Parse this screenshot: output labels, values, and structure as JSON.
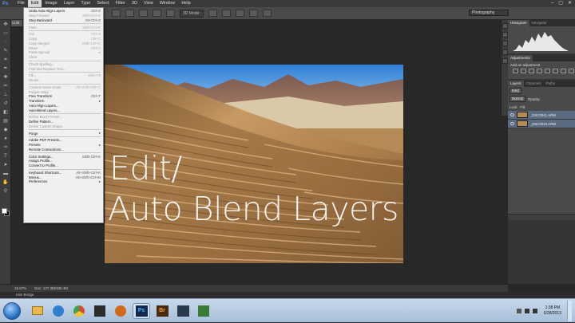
{
  "app": {
    "logo": "Ps"
  },
  "menubar": {
    "items": [
      "File",
      "Edit",
      "Image",
      "Layer",
      "Type",
      "Select",
      "Filter",
      "3D",
      "View",
      "Window",
      "Help"
    ],
    "active": "Edit"
  },
  "window_controls": {
    "minimize": "–",
    "restore": "▢",
    "close": "✕"
  },
  "options_bar": {
    "mode_label": "3D Mode:"
  },
  "workspace": {
    "selected": "Photography"
  },
  "document_tab": {
    "label": "Untit"
  },
  "edit_menu": [
    {
      "label": "Undo Auto-Align Layers",
      "shortcut": "Ctrl+Z"
    },
    {
      "label": "Step Forward",
      "shortcut": "Shift+Ctrl+Z",
      "disabled": true
    },
    {
      "label": "Step Backward",
      "shortcut": "Alt+Ctrl+Z"
    },
    {
      "sep": true
    },
    {
      "label": "Fade...",
      "shortcut": "Shift+Ctrl+F",
      "disabled": true
    },
    {
      "sep": true
    },
    {
      "label": "Cut",
      "shortcut": "Ctrl+X",
      "disabled": true
    },
    {
      "label": "Copy",
      "shortcut": "Ctrl+C",
      "disabled": true
    },
    {
      "label": "Copy Merged",
      "shortcut": "Shift+Ctrl+C",
      "disabled": true
    },
    {
      "label": "Paste",
      "shortcut": "Ctrl+V",
      "disabled": true
    },
    {
      "label": "Paste Special",
      "shortcut": "",
      "disabled": true,
      "submenu": true
    },
    {
      "label": "Clear",
      "shortcut": "",
      "disabled": true
    },
    {
      "sep": true
    },
    {
      "label": "Check Spelling...",
      "shortcut": "",
      "disabled": true
    },
    {
      "label": "Find and Replace Text...",
      "shortcut": "",
      "disabled": true
    },
    {
      "sep": true
    },
    {
      "label": "Fill...",
      "shortcut": "Shift+F5",
      "disabled": true
    },
    {
      "label": "Stroke...",
      "shortcut": "",
      "disabled": true
    },
    {
      "sep": true
    },
    {
      "label": "Content-Aware Scale",
      "shortcut": "Alt+Shift+Ctrl+C",
      "disabled": true
    },
    {
      "label": "Puppet Warp",
      "shortcut": "",
      "disabled": true
    },
    {
      "label": "Free Transform",
      "shortcut": "Ctrl+T"
    },
    {
      "label": "Transform",
      "shortcut": "",
      "submenu": true
    },
    {
      "label": "Auto-Align Layers...",
      "shortcut": ""
    },
    {
      "label": "Auto-Blend Layers...",
      "shortcut": ""
    },
    {
      "sep": true
    },
    {
      "label": "Define Brush Preset...",
      "shortcut": "",
      "disabled": true
    },
    {
      "label": "Define Pattern...",
      "shortcut": ""
    },
    {
      "label": "Define Custom Shape...",
      "shortcut": "",
      "disabled": true
    },
    {
      "sep": true
    },
    {
      "label": "Purge",
      "shortcut": "",
      "submenu": true
    },
    {
      "sep": true
    },
    {
      "label": "Adobe PDF Presets...",
      "shortcut": ""
    },
    {
      "label": "Presets",
      "shortcut": "",
      "submenu": true
    },
    {
      "label": "Remote Connections...",
      "shortcut": ""
    },
    {
      "sep": true
    },
    {
      "label": "Color Settings...",
      "shortcut": "Shift+Ctrl+K"
    },
    {
      "label": "Assign Profile...",
      "shortcut": ""
    },
    {
      "label": "Convert to Profile...",
      "shortcut": ""
    },
    {
      "sep": true
    },
    {
      "label": "Keyboard Shortcuts...",
      "shortcut": "Alt+Shift+Ctrl+K"
    },
    {
      "label": "Menus...",
      "shortcut": "Alt+Shift+Ctrl+M"
    },
    {
      "label": "Preferences",
      "shortcut": "",
      "submenu": true
    }
  ],
  "overlay": {
    "line1": "Edit/",
    "line2": "Auto Blend Layers"
  },
  "panels": {
    "histogram_tabs": [
      "Histogram",
      "Navigator"
    ],
    "adjustments": {
      "tab": "Adjustments",
      "subtitle": "Add an adjustment"
    },
    "layers_tabs": [
      "Layers",
      "Channels",
      "Paths"
    ],
    "kind_label": "Kind",
    "blend_mode": "Normal",
    "opacity_label": "Opacity:",
    "lock_label": "Lock:",
    "fill_label": "Fill:",
    "layers": [
      {
        "name": "_DSC0041.ARW"
      },
      {
        "name": "_DSC0043.ARW"
      }
    ]
  },
  "status_bar": {
    "zoom": "16.67%",
    "doc": "Doc: 137.3M/330.4M"
  },
  "mini_bridge": {
    "label": "Mini Bridge"
  },
  "taskbar": {
    "apps": [
      {
        "icon": "folder-icon",
        "color": "#e8b84a"
      },
      {
        "icon": "ie-icon",
        "color": "#2f7fd1"
      },
      {
        "icon": "chrome-icon",
        "color": "#d94a3a"
      },
      {
        "icon": "app-icon",
        "color": "#2c2c2c"
      },
      {
        "icon": "media-icon",
        "color": "#d16a1a"
      },
      {
        "icon": "photoshop-icon",
        "color": "#0e2a4d"
      },
      {
        "icon": "bridge-icon",
        "color": "#4a2a0e"
      },
      {
        "icon": "lightroom-icon",
        "color": "#2a3a4d"
      },
      {
        "icon": "app2-icon",
        "color": "#3a7a3a"
      }
    ],
    "ps_label": "Ps",
    "br_label": "Br"
  },
  "clock": {
    "time": "1:38 PM",
    "date": "6/28/2013"
  }
}
